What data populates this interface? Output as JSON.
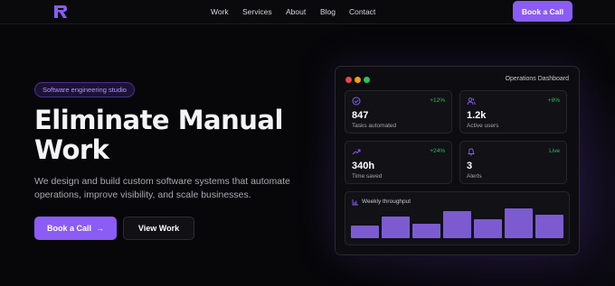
{
  "nav": {
    "links": [
      "Work",
      "Services",
      "About",
      "Blog",
      "Contact"
    ],
    "cta": "Book a Call"
  },
  "hero": {
    "badge": "Software engineering studio",
    "title_line1": "Eliminate Manual",
    "title_line2": "Work",
    "subtitle_line1": "We design and build custom software systems that automate",
    "subtitle_line2": "operations, improve visibility, and scale businesses.",
    "primary_button": "Book a Call",
    "primary_button_arrow": "→",
    "secondary_button": "View Work"
  },
  "dashboard": {
    "title": "Operations Dashboard",
    "window_dot_colors": [
      "#ef4444",
      "#f59e0b",
      "#22c55e"
    ],
    "cards": [
      {
        "icon": "check-circle-icon",
        "delta": "+12%",
        "value": "847",
        "label": "Tasks automated"
      },
      {
        "icon": "users-icon",
        "delta": "+8%",
        "value": "1.2k",
        "label": "Active users"
      },
      {
        "icon": "trend-up-icon",
        "delta": "+24%",
        "value": "340h",
        "label": "Time saved"
      },
      {
        "icon": "bell-icon",
        "delta": "Live",
        "value": "3",
        "label": "Alerts"
      }
    ],
    "weekly": {
      "title": "Weekly throughput",
      "bar_levels": [
        0.38,
        0.68,
        0.45,
        0.82,
        0.57,
        0.93,
        0.72
      ]
    }
  },
  "colors": {
    "accent": "#8b5cf6",
    "positive": "#22c55e",
    "background": "#070709"
  }
}
